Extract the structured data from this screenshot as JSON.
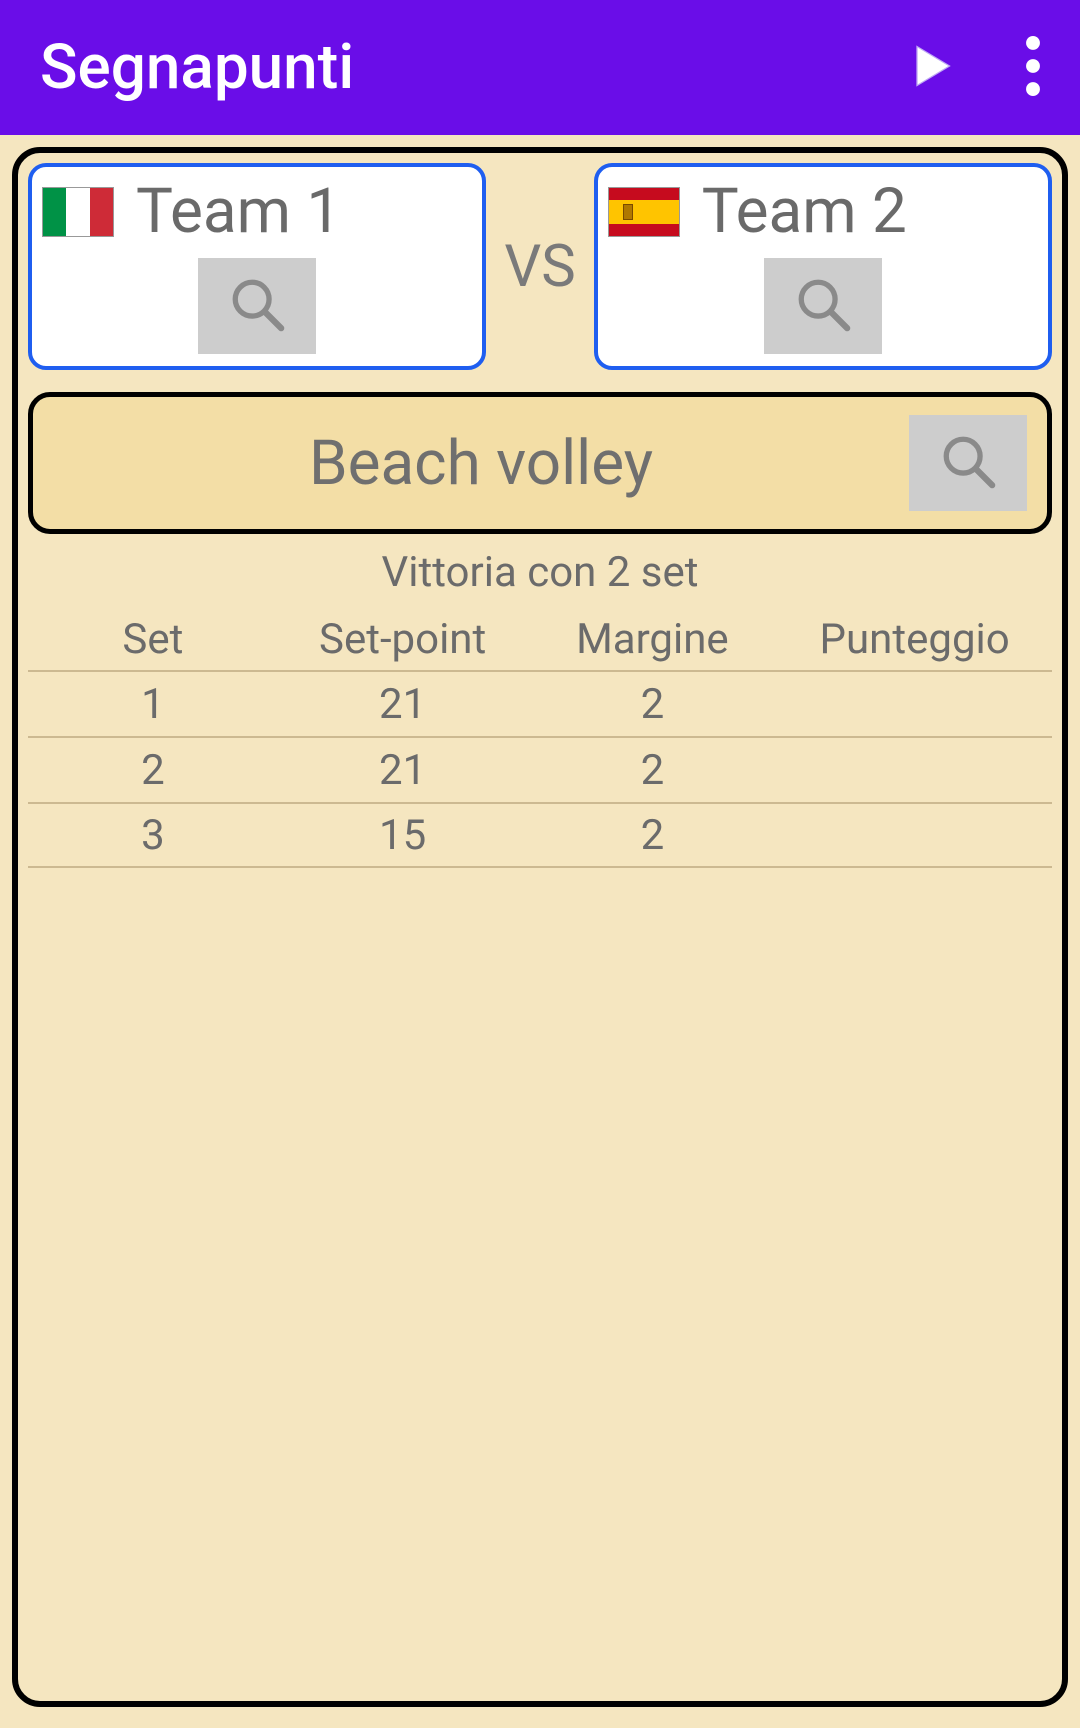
{
  "header": {
    "title": "Segnapunti"
  },
  "teams": {
    "vs_label": "VS",
    "team1": {
      "name": "Team 1",
      "flag": "it"
    },
    "team2": {
      "name": "Team 2",
      "flag": "es"
    }
  },
  "sport": {
    "name": "Beach volley"
  },
  "win_condition": "Vittoria con 2 set",
  "table": {
    "headers": {
      "set": "Set",
      "set_point": "Set-point",
      "margin": "Margine",
      "score": "Punteggio"
    },
    "rows": [
      {
        "set": "1",
        "set_point": "21",
        "margin": "2",
        "score": ""
      },
      {
        "set": "2",
        "set_point": "21",
        "margin": "2",
        "score": ""
      },
      {
        "set": "3",
        "set_point": "15",
        "margin": "2",
        "score": ""
      }
    ]
  }
}
